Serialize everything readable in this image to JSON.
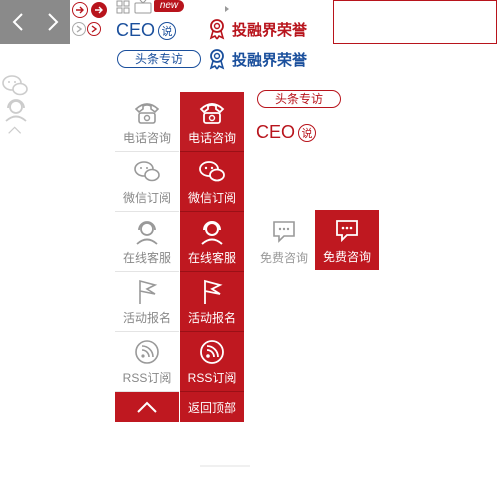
{
  "top": {
    "new_badge": "new",
    "ceo_label": "CEO",
    "shuo": "说",
    "toutiao_label": "头条专访",
    "honor_label": "投融界荣誉"
  },
  "float_bar": {
    "items": [
      {
        "label": "电话咨询",
        "icon": "phone-icon"
      },
      {
        "label": "微信订阅",
        "icon": "wechat-icon"
      },
      {
        "label": "在线客服",
        "icon": "customer-service-icon"
      },
      {
        "label": "活动报名",
        "icon": "flag-icon"
      },
      {
        "label": "RSS订阅",
        "icon": "rss-icon"
      }
    ],
    "back_top": "返回顶部"
  },
  "consult": {
    "label": "免费咨询"
  },
  "colors": {
    "brand_red": "#bf1820",
    "brand_blue": "#1a4f9c",
    "grey_text": "#888888"
  }
}
